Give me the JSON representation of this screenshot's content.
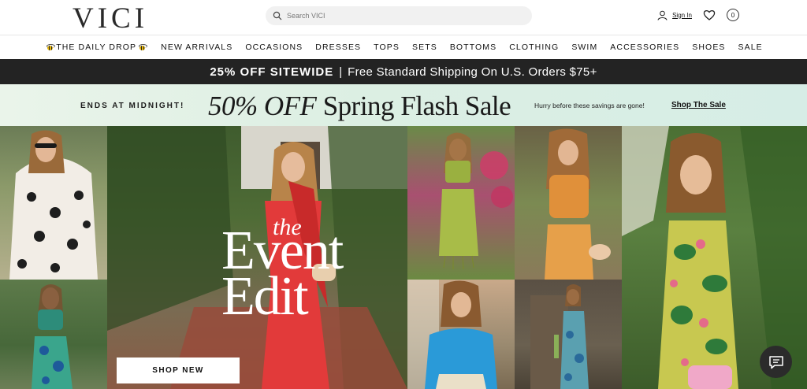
{
  "header": {
    "logo": "VICI",
    "search_placeholder": "Search VICI",
    "signin_label": "Sign In",
    "cart_count": "0"
  },
  "nav": {
    "items": [
      "THE DAILY DROP",
      "NEW ARRIVALS",
      "OCCASIONS",
      "DRESSES",
      "TOPS",
      "SETS",
      "BOTTOMS",
      "CLOTHING",
      "SWIM",
      "ACCESSORIES",
      "SHOES",
      "SALE"
    ]
  },
  "promo_bar": {
    "bold_text": "25% OFF SITEWIDE",
    "separator": "|",
    "rest_text": "Free Standard Shipping On U.S. Orders $75+"
  },
  "flash_banner": {
    "ends_text": "ENDS AT MIDNIGHT!",
    "headline_italic": "50% OFF",
    "headline_rest": " Spring Flash Sale",
    "subtext": "Hurry before these savings are gone!",
    "cta": "Shop The Sale"
  },
  "hero": {
    "title_small": "the",
    "title_line1": "Event",
    "title_line2": "Edit",
    "cta": "SHOP NEW"
  },
  "colors": {
    "promo_bg": "#232323",
    "flash_bg": "#dcefe3",
    "chat_bg": "#2b2b2b"
  }
}
